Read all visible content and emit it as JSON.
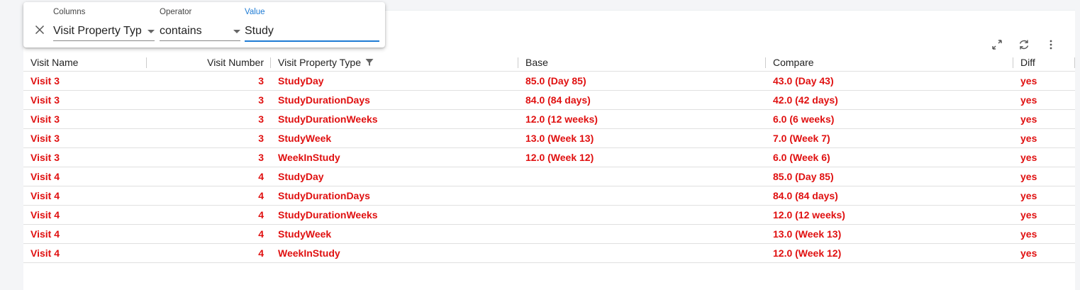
{
  "filter": {
    "columns_label": "Columns",
    "columns_value": "Visit Property Typ",
    "operator_label": "Operator",
    "operator_value": "contains",
    "value_label": "Value",
    "value_value": "Study"
  },
  "toolbar": {
    "icons": [
      "expand-icon",
      "refresh-icon",
      "more-vert-icon"
    ]
  },
  "table": {
    "headers": {
      "visit_name": "Visit Name",
      "visit_number": "Visit Number",
      "visit_property_type": "Visit Property Type",
      "base": "Base",
      "compare": "Compare",
      "diff": "Diff"
    },
    "rows": [
      {
        "visit_name": "Visit 3",
        "visit_number": "3",
        "visit_property_type": "StudyDay",
        "base": "85.0 (Day 85)",
        "compare": "43.0 (Day 43)",
        "diff": "yes"
      },
      {
        "visit_name": "Visit 3",
        "visit_number": "3",
        "visit_property_type": "StudyDurationDays",
        "base": "84.0 (84 days)",
        "compare": "42.0 (42 days)",
        "diff": "yes"
      },
      {
        "visit_name": "Visit 3",
        "visit_number": "3",
        "visit_property_type": "StudyDurationWeeks",
        "base": "12.0 (12 weeks)",
        "compare": "6.0 (6 weeks)",
        "diff": "yes"
      },
      {
        "visit_name": "Visit 3",
        "visit_number": "3",
        "visit_property_type": "StudyWeek",
        "base": "13.0 (Week 13)",
        "compare": "7.0 (Week 7)",
        "diff": "yes"
      },
      {
        "visit_name": "Visit 3",
        "visit_number": "3",
        "visit_property_type": "WeekInStudy",
        "base": "12.0 (Week 12)",
        "compare": "6.0 (Week 6)",
        "diff": "yes"
      },
      {
        "visit_name": "Visit 4",
        "visit_number": "4",
        "visit_property_type": "StudyDay",
        "base": "",
        "compare": "85.0 (Day 85)",
        "diff": "yes"
      },
      {
        "visit_name": "Visit 4",
        "visit_number": "4",
        "visit_property_type": "StudyDurationDays",
        "base": "",
        "compare": "84.0 (84 days)",
        "diff": "yes"
      },
      {
        "visit_name": "Visit 4",
        "visit_number": "4",
        "visit_property_type": "StudyDurationWeeks",
        "base": "",
        "compare": "12.0 (12 weeks)",
        "diff": "yes"
      },
      {
        "visit_name": "Visit 4",
        "visit_number": "4",
        "visit_property_type": "StudyWeek",
        "base": "",
        "compare": "13.0 (Week 13)",
        "diff": "yes"
      },
      {
        "visit_name": "Visit 4",
        "visit_number": "4",
        "visit_property_type": "WeekInStudy",
        "base": "",
        "compare": "12.0 (Week 12)",
        "diff": "yes"
      }
    ]
  },
  "colors": {
    "diff_text": "#e01010",
    "accent": "#1e7bd4"
  }
}
